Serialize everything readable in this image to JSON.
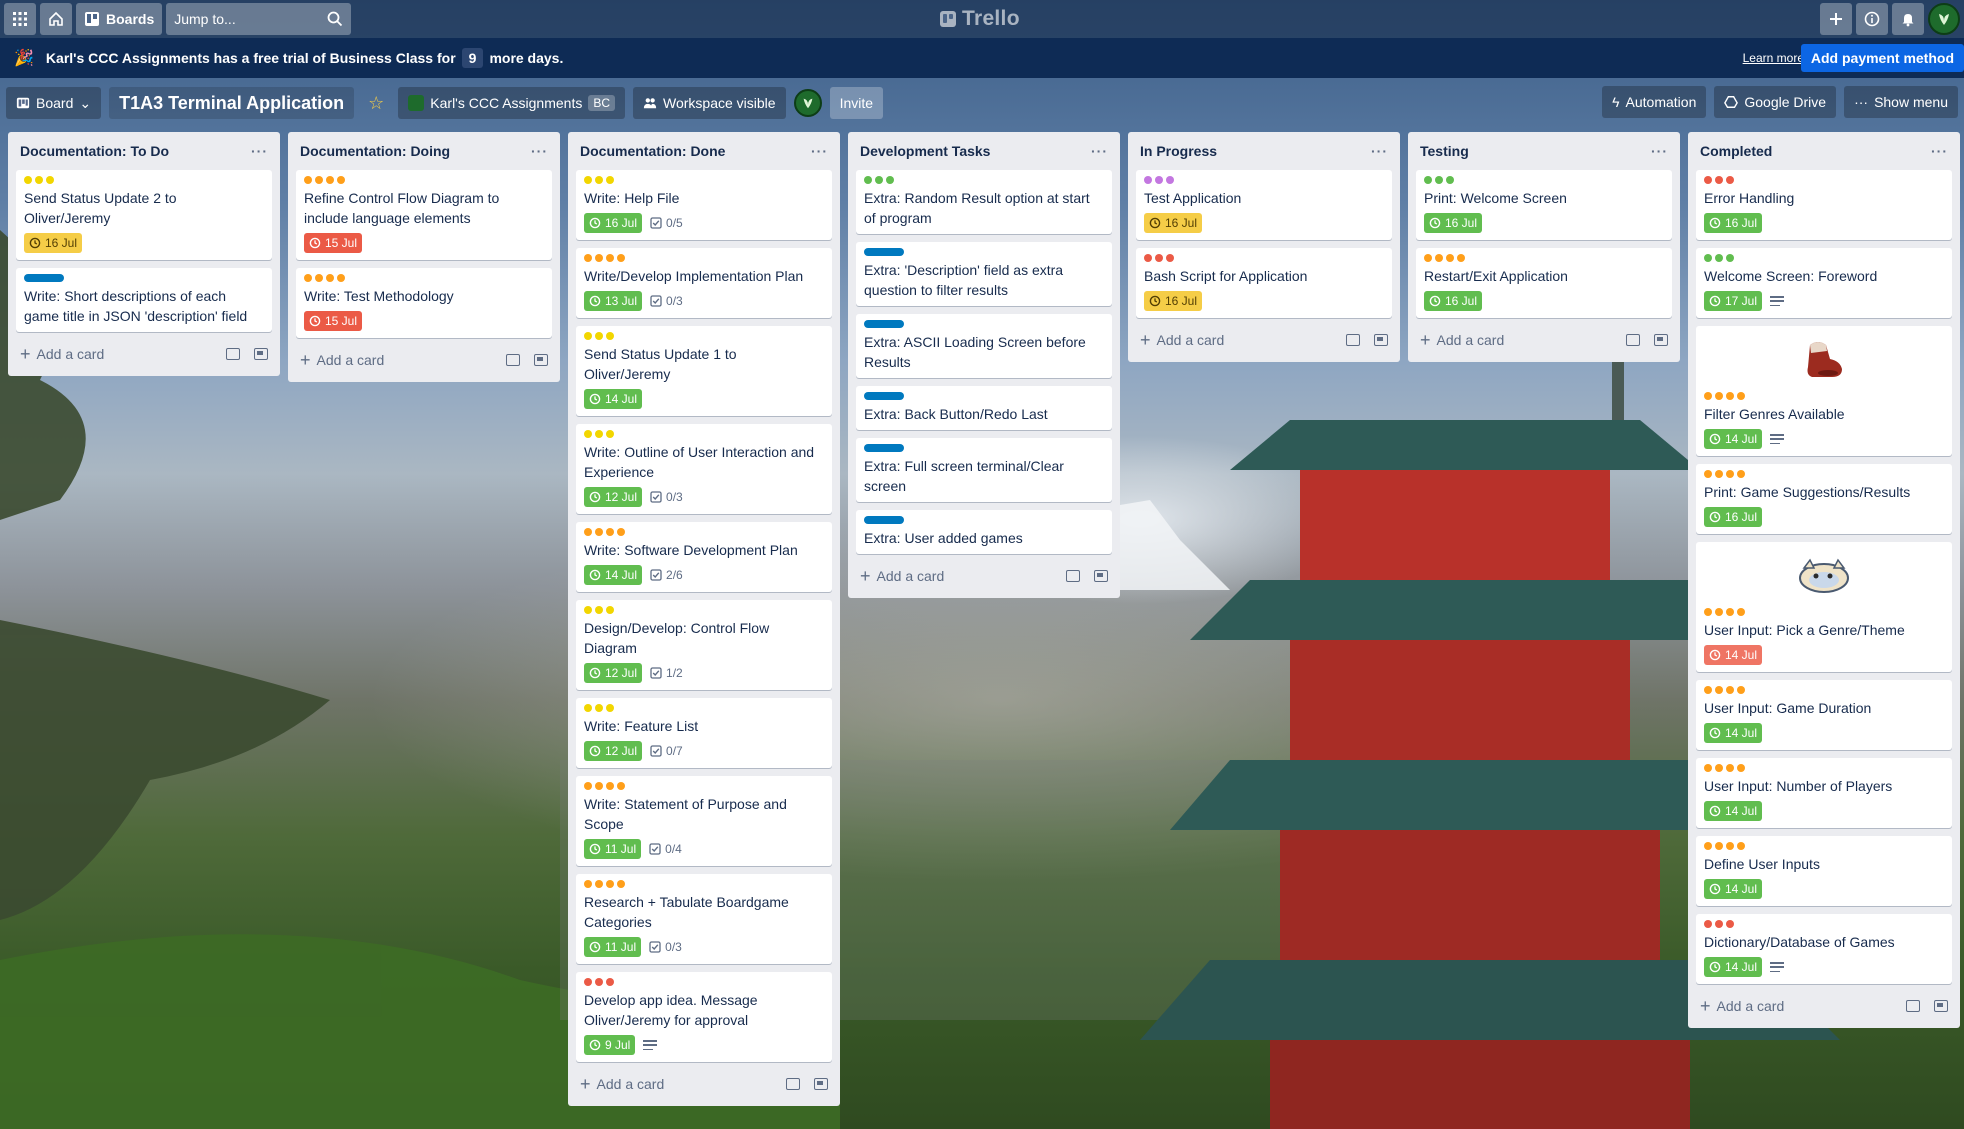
{
  "colors": {
    "yellow": "#f2d600",
    "orange": "#ff9f1a",
    "red": "#eb5a46",
    "green": "#61bd4f",
    "blue": "#0079bf",
    "purple": "#c377e0",
    "due_yellow": "#f5cd47",
    "due_red": "#eb5a46",
    "due_green": "#61bd4f",
    "due_pink": "#ef7564",
    "banner_bg": "#0e2b55",
    "primary": "#0c66e4"
  },
  "header": {
    "boards_label": "Boards",
    "jump_placeholder": "Jump to...",
    "logo_text": "Trello",
    "icons": [
      "apps-icon",
      "home-icon",
      "boards-icon",
      "search-icon",
      "plus-icon",
      "info-icon",
      "bell-icon",
      "avatar"
    ]
  },
  "banner": {
    "text_before": "Karl's CCC Assignments has a free trial of Business Class for",
    "days": "9",
    "text_after": "more days.",
    "learn_more": "Learn more",
    "pay_button": "Add payment method"
  },
  "board_header": {
    "view_label": "Board",
    "title": "T1A3 Terminal Application",
    "workspace": "Karl's CCC Assignments",
    "workspace_badge": "BC",
    "visibility": "Workspace visible",
    "invite": "Invite",
    "automation": "Automation",
    "google_drive": "Google Drive",
    "show_menu": "Show menu"
  },
  "add_card_label": "Add a card",
  "lists": [
    {
      "title": "Documentation: To Do",
      "cards": [
        {
          "labels": [
            "yellow",
            "yellow",
            "yellow"
          ],
          "title": "Send Status Update 2 to Oliver/Jeremy",
          "due": "16 Jul",
          "due_color": "yellow"
        },
        {
          "labels": [
            "blue-wide"
          ],
          "title": "Write: Short descriptions of each game title in JSON 'description' field"
        }
      ]
    },
    {
      "title": "Documentation: Doing",
      "cards": [
        {
          "labels": [
            "orange",
            "orange",
            "orange",
            "orange"
          ],
          "title": "Refine Control Flow Diagram to include language elements",
          "due": "15 Jul",
          "due_color": "red"
        },
        {
          "labels": [
            "orange",
            "orange",
            "orange",
            "orange"
          ],
          "title": "Write: Test Methodology",
          "due": "15 Jul",
          "due_color": "red"
        }
      ]
    },
    {
      "title": "Documentation: Done",
      "cards": [
        {
          "labels": [
            "yellow",
            "yellow",
            "yellow"
          ],
          "title": "Write: Help File",
          "due": "16 Jul",
          "due_color": "green",
          "checklist": "0/5"
        },
        {
          "labels": [
            "orange",
            "orange",
            "orange",
            "orange"
          ],
          "title": "Write/Develop Implementation Plan",
          "due": "13 Jul",
          "due_color": "green",
          "checklist": "0/3"
        },
        {
          "labels": [
            "yellow",
            "yellow",
            "yellow"
          ],
          "title": "Send Status Update 1 to Oliver/Jeremy",
          "due": "14 Jul",
          "due_color": "green"
        },
        {
          "labels": [
            "yellow",
            "yellow",
            "yellow"
          ],
          "title": "Write: Outline of User Interaction and Experience",
          "due": "12 Jul",
          "due_color": "green",
          "checklist": "0/3"
        },
        {
          "labels": [
            "orange",
            "orange",
            "orange",
            "orange"
          ],
          "title": "Write: Software Development Plan",
          "due": "14 Jul",
          "due_color": "green",
          "checklist": "2/6"
        },
        {
          "labels": [
            "yellow",
            "yellow",
            "yellow"
          ],
          "title": "Design/Develop: Control Flow Diagram",
          "due": "12 Jul",
          "due_color": "green",
          "checklist": "1/2"
        },
        {
          "labels": [
            "yellow",
            "yellow",
            "yellow"
          ],
          "title": "Write: Feature List",
          "due": "12 Jul",
          "due_color": "green",
          "checklist": "0/7"
        },
        {
          "labels": [
            "orange",
            "orange",
            "orange",
            "orange"
          ],
          "title": "Write: Statement of Purpose and Scope",
          "due": "11 Jul",
          "due_color": "green",
          "checklist": "0/4"
        },
        {
          "labels": [
            "orange",
            "orange",
            "orange",
            "orange"
          ],
          "title": "Research + Tabulate Boardgame Categories",
          "due": "11 Jul",
          "due_color": "green",
          "checklist": "0/3"
        },
        {
          "labels": [
            "red",
            "red",
            "red"
          ],
          "title": "Develop app idea. Message Oliver/Jeremy for approval",
          "due": "9 Jul",
          "due_color": "green",
          "description": true
        }
      ]
    },
    {
      "title": "Development Tasks",
      "cards": [
        {
          "labels": [
            "green",
            "green",
            "green"
          ],
          "title": "Extra: Random Result option at start of program"
        },
        {
          "labels": [
            "blue-wide"
          ],
          "title": "Extra: 'Description' field as extra question to filter results"
        },
        {
          "labels": [
            "blue-wide"
          ],
          "title": "Extra: ASCII Loading Screen before Results"
        },
        {
          "labels": [
            "blue-wide"
          ],
          "title": "Extra: Back Button/Redo Last"
        },
        {
          "labels": [
            "blue-wide"
          ],
          "title": "Extra: Full screen terminal/Clear screen"
        },
        {
          "labels": [
            "blue-wide"
          ],
          "title": "Extra: User added games"
        }
      ]
    },
    {
      "title": "In Progress",
      "cards": [
        {
          "labels": [
            "purple",
            "purple",
            "purple"
          ],
          "title": "Test Application",
          "due": "16 Jul",
          "due_color": "yellow"
        },
        {
          "labels": [
            "red",
            "red",
            "red"
          ],
          "title": "Bash Script for Application",
          "due": "16 Jul",
          "due_color": "yellow"
        }
      ]
    },
    {
      "title": "Testing",
      "cards": [
        {
          "labels": [
            "green",
            "green",
            "green"
          ],
          "title": "Print: Welcome Screen",
          "due": "16 Jul",
          "due_color": "green"
        },
        {
          "labels": [
            "orange",
            "orange",
            "orange",
            "orange"
          ],
          "title": "Restart/Exit Application",
          "due": "16 Jul",
          "due_color": "green"
        }
      ]
    },
    {
      "title": "Completed",
      "cards": [
        {
          "labels": [
            "red",
            "red",
            "red"
          ],
          "title": "Error Handling",
          "due": "16 Jul",
          "due_color": "green"
        },
        {
          "labels": [
            "green",
            "green",
            "green"
          ],
          "title": "Welcome Screen: Foreword",
          "due": "17 Jul",
          "due_color": "green",
          "description": true
        },
        {
          "cover": "boot",
          "labels": [
            "orange",
            "orange",
            "orange",
            "orange"
          ],
          "title": "Filter Genres Available",
          "due": "14 Jul",
          "due_color": "green",
          "description": true
        },
        {
          "labels": [
            "orange",
            "orange",
            "orange",
            "orange"
          ],
          "title": "Print: Game Suggestions/Results",
          "due": "16 Jul",
          "due_color": "green"
        },
        {
          "cover": "cat",
          "labels": [
            "orange",
            "orange",
            "orange",
            "orange"
          ],
          "title": "User Input: Pick a Genre/Theme",
          "due": "14 Jul",
          "due_color": "pink"
        },
        {
          "labels": [
            "orange",
            "orange",
            "orange",
            "orange"
          ],
          "title": "User Input: Game Duration",
          "due": "14 Jul",
          "due_color": "green"
        },
        {
          "labels": [
            "orange",
            "orange",
            "orange",
            "orange"
          ],
          "title": "User Input: Number of Players",
          "due": "14 Jul",
          "due_color": "green"
        },
        {
          "labels": [
            "orange",
            "orange",
            "orange",
            "orange"
          ],
          "title": "Define User Inputs",
          "due": "14 Jul",
          "due_color": "green"
        },
        {
          "labels": [
            "red",
            "red",
            "red"
          ],
          "title": "Dictionary/Database of Games",
          "due": "14 Jul",
          "due_color": "green",
          "description": true
        }
      ]
    }
  ]
}
